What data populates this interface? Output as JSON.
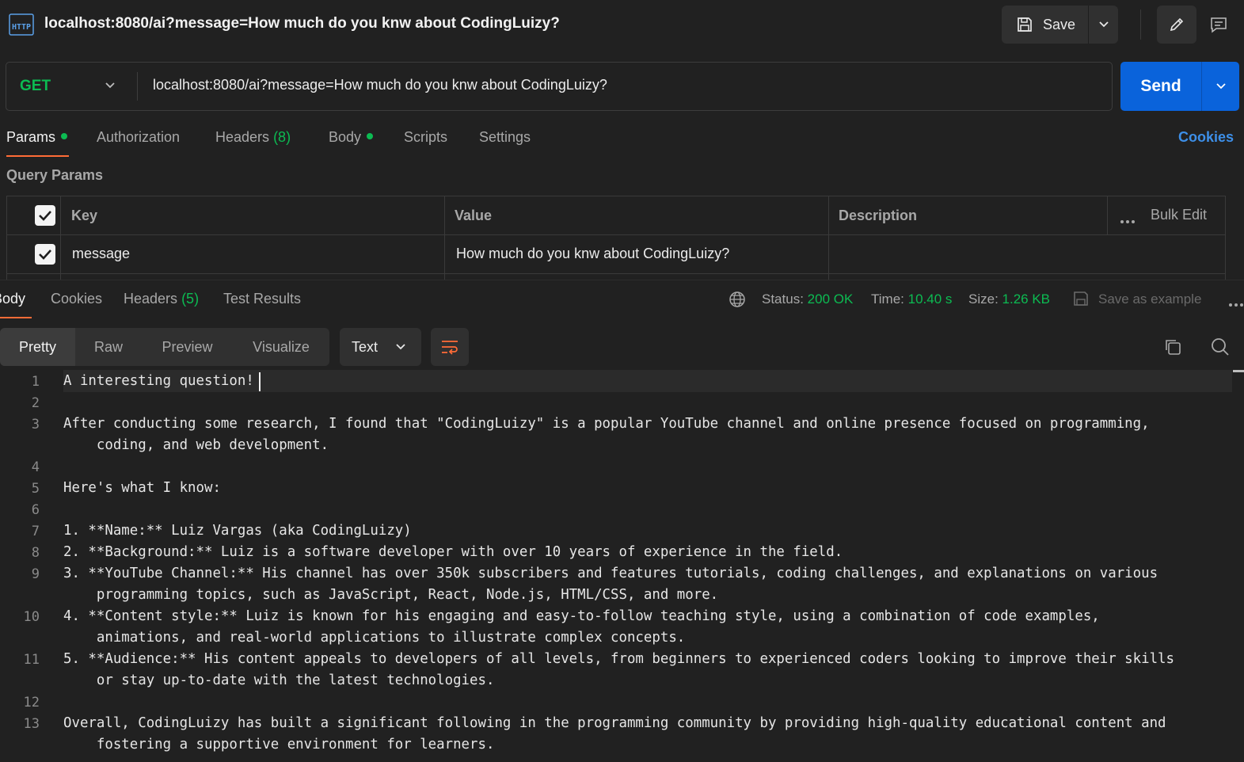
{
  "header": {
    "http_icon_label": "HTTP",
    "title": "localhost:8080/ai?message=How much do you knw about CodingLuizy?",
    "save_label": "Save"
  },
  "request": {
    "method": "GET",
    "url": "localhost:8080/ai?message=How much do you knw about CodingLuizy?",
    "send_label": "Send"
  },
  "request_tabs": {
    "params": "Params",
    "authorization": "Authorization",
    "headers": "Headers",
    "headers_count": "(8)",
    "body": "Body",
    "scripts": "Scripts",
    "settings": "Settings",
    "cookies": "Cookies"
  },
  "query_params": {
    "heading": "Query Params",
    "columns": {
      "key": "Key",
      "value": "Value",
      "description": "Description",
      "bulk_edit": "Bulk Edit"
    },
    "rows": [
      {
        "checked": true,
        "key": "message",
        "value": "How much do you knw about CodingLuizy?",
        "description": ""
      }
    ]
  },
  "response_tabs": {
    "body": "Body",
    "cookies": "Cookies",
    "headers": "Headers",
    "headers_count": "(5)",
    "test_results": "Test Results"
  },
  "response_meta": {
    "status_label": "Status:",
    "status_value": "200 OK",
    "time_label": "Time:",
    "time_value": "10.40 s",
    "size_label": "Size:",
    "size_value": "1.26 KB",
    "save_example": "Save as example"
  },
  "view": {
    "modes": [
      "Pretty",
      "Raw",
      "Preview",
      "Visualize"
    ],
    "format": "Text"
  },
  "colors": {
    "accent": "#ff6c37",
    "success": "#0cbb52",
    "send": "#0a63db",
    "link": "#3d8fe8"
  },
  "editor": {
    "lines": [
      {
        "n": "1",
        "text": "A interesting question!"
      },
      {
        "n": "2",
        "text": ""
      },
      {
        "n": "3",
        "text": "After conducting some research, I found that \"CodingLuizy\" is a popular YouTube channel and online presence focused on programming,",
        "cont": "    coding, and web development."
      },
      {
        "n": "4",
        "text": ""
      },
      {
        "n": "5",
        "text": "Here's what I know:"
      },
      {
        "n": "6",
        "text": ""
      },
      {
        "n": "7",
        "text": "1. **Name:** Luiz Vargas (aka CodingLuizy)"
      },
      {
        "n": "8",
        "text": "2. **Background:** Luiz is a software developer with over 10 years of experience in the field."
      },
      {
        "n": "9",
        "text": "3. **YouTube Channel:** His channel has over 350k subscribers and features tutorials, coding challenges, and explanations on various",
        "cont": "    programming topics, such as JavaScript, React, Node.js, HTML/CSS, and more."
      },
      {
        "n": "10",
        "text": "4. **Content style:** Luiz is known for his engaging and easy-to-follow teaching style, using a combination of code examples,",
        "cont": "    animations, and real-world applications to illustrate complex concepts."
      },
      {
        "n": "11",
        "text": "5. **Audience:** His content appeals to developers of all levels, from beginners to experienced coders looking to improve their skills",
        "cont": "    or stay up-to-date with the latest technologies."
      },
      {
        "n": "12",
        "text": ""
      },
      {
        "n": "13",
        "text": "Overall, CodingLuizy has built a significant following in the programming community by providing high-quality educational content and",
        "cont": "    fostering a supportive environment for learners."
      }
    ]
  }
}
